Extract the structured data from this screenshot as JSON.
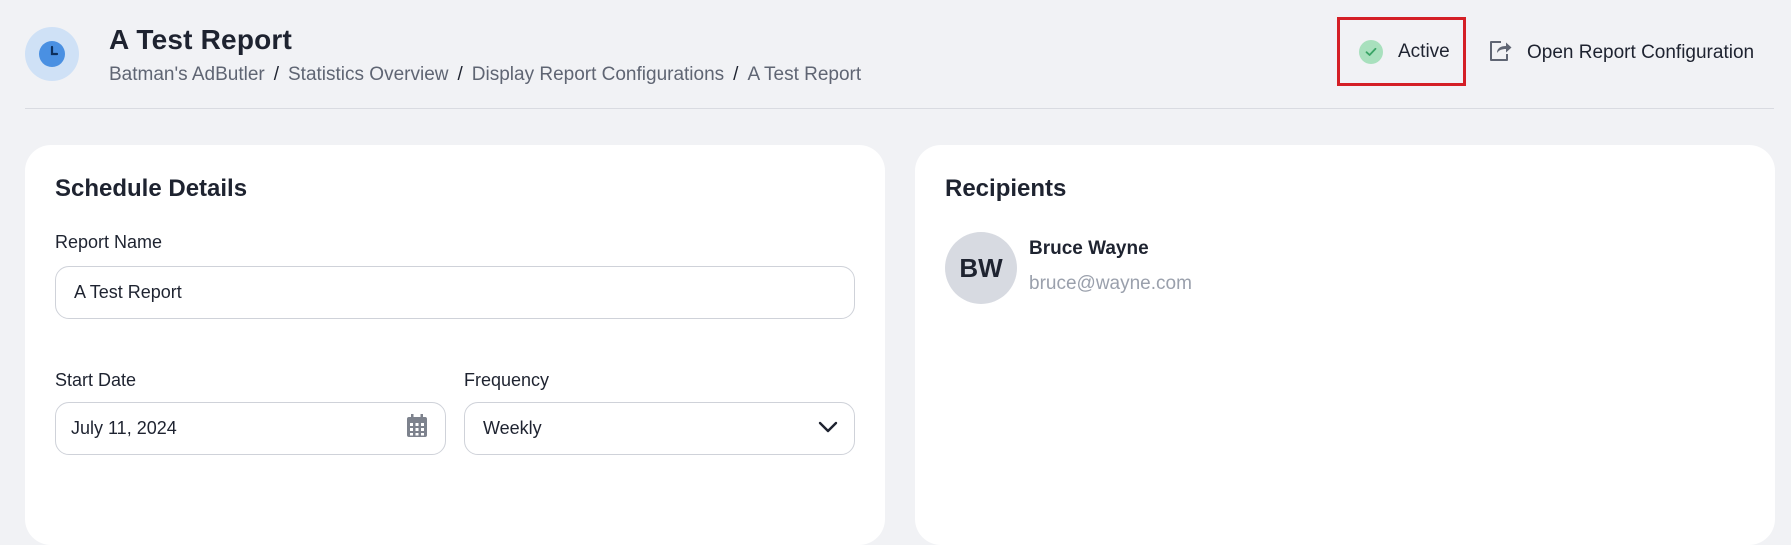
{
  "header": {
    "icon": "clock-icon",
    "title": "A Test Report",
    "breadcrumb": [
      "Batman's AdButler",
      "Statistics Overview",
      "Display Report Configurations",
      "A Test Report"
    ],
    "breadcrumb_separator": "/",
    "status": {
      "label": "Active",
      "icon": "check-circle-icon",
      "color": "#a8e0bd"
    },
    "open_config": {
      "label": "Open Report Configuration",
      "icon": "share-arrow-icon"
    }
  },
  "schedule": {
    "title": "Schedule Details",
    "report_name": {
      "label": "Report Name",
      "value": "A Test Report"
    },
    "start_date": {
      "label": "Start Date",
      "value": "July 11, 2024",
      "icon": "calendar-icon"
    },
    "frequency": {
      "label": "Frequency",
      "value": "Weekly",
      "icon": "chevron-down-icon"
    }
  },
  "recipients": {
    "title": "Recipients",
    "items": [
      {
        "initials": "BW",
        "name": "Bruce Wayne",
        "email": "bruce@wayne.com"
      }
    ]
  },
  "colors": {
    "background": "#f1f2f5",
    "highlight_border": "#d41f26",
    "accent_blue": "#4a90e2"
  }
}
